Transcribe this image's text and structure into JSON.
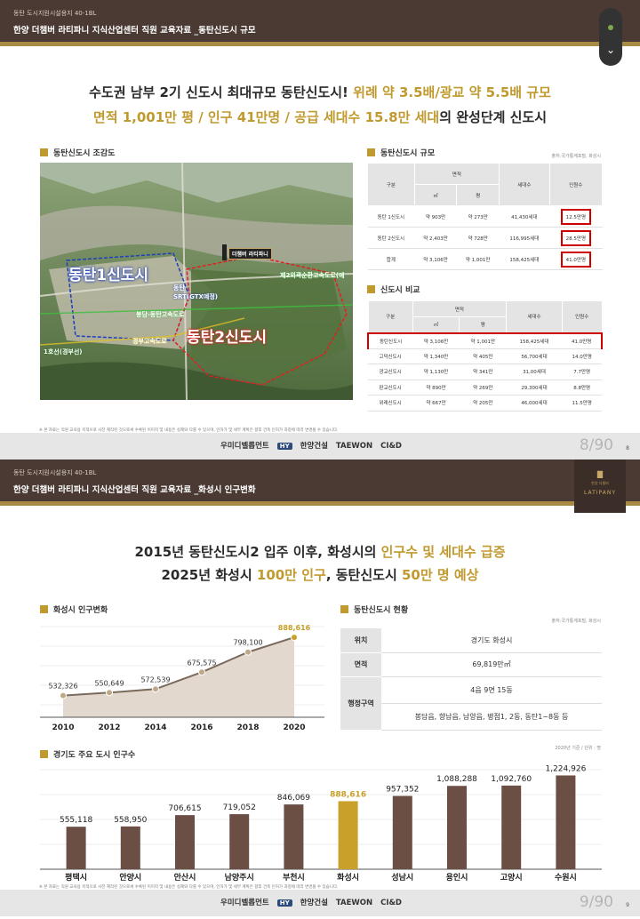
{
  "slide1": {
    "header": {
      "top": "동탄 도시지원시설용지 40-1BL",
      "title": "한양 더챔버 라티파니 지식산업센터 직원 교육자료 _동탄신도시 규모"
    },
    "headline": {
      "line1_a": "수도권 남부 2기 신도시 최대규모 동탄신도시!",
      "line1_b": "위례 약 3.5배/광교 약 5.5배 규모",
      "line2_a": "면적 1,001만 평 / 인구 41만명 / 공급 세대수 15.8만 세대",
      "line2_b": "의 완성단계 신도시"
    },
    "map_section": {
      "title": "동탄신도시 조감도",
      "labels": {
        "dongtan1": "동탄1신도시",
        "dongtan2": "동탄2신도시",
        "site": "더챔버 라티파니",
        "srt": "동탄\nSRT(GTX예정)",
        "highway": "제2외곽순환고속도로(예",
        "bongdam": "봉담-동탄고속도로",
        "gyeongbu": "경부고속도로",
        "line1": "1호선(경부선)"
      }
    },
    "scale_table": {
      "title": "동탄신도시 규모",
      "source": "출처:국가통계포털, 화성시",
      "headers": {
        "name": "구분",
        "area": "면적",
        "sqm": "㎡",
        "pyeong": "평",
        "households": "세대수",
        "population": "인원수"
      },
      "rows": [
        {
          "name": "동탄 1신도시",
          "sqm": "약 903만",
          "pyeong": "약 273만",
          "households": "41,430세대",
          "population": "12.5만명"
        },
        {
          "name": "동탄 2신도시",
          "sqm": "약 2,403만",
          "pyeong": "약 728만",
          "households": "116,995세대",
          "population": "28.5만명"
        },
        {
          "name": "합계",
          "sqm": "약 3,106만",
          "pyeong": "약 1,001만",
          "households": "158,425세대",
          "population": "41.0만명"
        }
      ]
    },
    "compare_table": {
      "title": "신도시 비교",
      "headers": {
        "name": "구분",
        "area": "면적",
        "sqm": "㎡",
        "pyeong": "평",
        "households": "세대수",
        "population": "인원수"
      },
      "rows": [
        {
          "name": "동탄신도시",
          "sqm": "약 3,106만",
          "pyeong": "약 1,001만",
          "households": "158,425세대",
          "population": "41.0만명"
        },
        {
          "name": "고덕신도시",
          "sqm": "약 1,340만",
          "pyeong": "약 405만",
          "households": "56,700세대",
          "population": "14.0만명"
        },
        {
          "name": "광교신도시",
          "sqm": "약 1,130만",
          "pyeong": "약 341만",
          "households": "31,00세대",
          "population": "7.7만명"
        },
        {
          "name": "판교신도시",
          "sqm": "약 890만",
          "pyeong": "약 269만",
          "households": "29,300세대",
          "population": "8.8만명"
        },
        {
          "name": "위례신도시",
          "sqm": "약 667만",
          "pyeong": "약 205만",
          "households": "46,000세대",
          "population": "11.5만명"
        }
      ]
    },
    "footnote": "※ 본 자료는 직원 교육용 목적으로 사전 제작된 것으로써 수록된 이미지 및 내용은 실제와 다를 수 있으며, 인허가 및 세부 계획은 향후 건축 인허가 과정에 따라 변경될 수 있습니다.",
    "page": "8/90",
    "page_small": "8"
  },
  "slide2": {
    "header": {
      "top": "동탄 도시지원시설용지 40-1BL",
      "title": "한양 더챔버 라티파니 지식산업센터 직원 교육자료 _화성시 인구변화"
    },
    "logo": {
      "emblem": "▇",
      "sub": "한양 더챔버",
      "name": "LATIPANY"
    },
    "headline": {
      "line1_a": "2015년 동탄신도시2 입주 이후, 화성시의 ",
      "line1_b": "인구수 및 세대수 급증",
      "line2_a": "2025년 화성시 ",
      "line2_b": "100만 인구",
      "line2_c": ", 동탄신도시 ",
      "line2_d": "50만 명 예상"
    },
    "pop_section_title": "화성시 인구변화",
    "status_section": {
      "title": "동탄신도시 현황",
      "source": "출처:국가통계포털, 화성시",
      "rows": [
        {
          "label": "위치",
          "value": "경기도 화성시"
        },
        {
          "label": "면적",
          "value": "69,819만㎡"
        },
        {
          "label": "행정구역",
          "value": "4읍 9면 15동",
          "value2": "봉담읍, 향남읍, 남양읍, 병점1, 2동, 동탄1~8동 등"
        }
      ]
    },
    "city_section": {
      "title": "경기도 주요 도시 인구수",
      "note": "2020년 기준 / 단위 : 명"
    },
    "footnote": "※ 본 자료는 직원 교육용 목적으로 사전 제작된 것으로써 수록된 이미지 및 내용은 실제와 다를 수 있으며, 인허가 및 세부 계획은 향후 건축 인허가 과정에 따라 변경될 수 있습니다.",
    "page": "9/90",
    "page_small": "9"
  },
  "footer_logos": {
    "woomi": "우미디벨롭먼트",
    "hy": "HY",
    "hanyang": "한양건설",
    "taewon": "TAEWON",
    "cid": "CI&D"
  },
  "colors": {
    "brown": "#4a3a33",
    "gold": "#c19a2f",
    "bar": "#6b4f45",
    "highlight_bar": "#c9a12a"
  },
  "chart_data": [
    {
      "type": "area",
      "x": [
        "2010",
        "2012",
        "2014",
        "2016",
        "2018",
        "2020"
      ],
      "series": [
        {
          "values": [
            532326,
            550649,
            572539,
            675575,
            798100,
            888616
          ]
        }
      ],
      "value_labels": [
        "532,326",
        "550,649",
        "572,539",
        "675,575",
        "798,100",
        "888,616"
      ],
      "highlight_index": 5
    },
    {
      "type": "bar",
      "categories": [
        "평택시",
        "안양시",
        "안산시",
        "남양주시",
        "부천시",
        "화성시",
        "성남시",
        "용인시",
        "고양시",
        "수원시"
      ],
      "values": [
        555118,
        558950,
        706615,
        719052,
        846069,
        888616,
        957352,
        1088288,
        1092760,
        1224926
      ],
      "value_labels": [
        "555,118",
        "558,950",
        "706,615",
        "719,052",
        "846,069",
        "888,616",
        "957,352",
        "1,088,288",
        "1,092,760",
        "1,224,926"
      ],
      "highlight_index": 5
    }
  ]
}
